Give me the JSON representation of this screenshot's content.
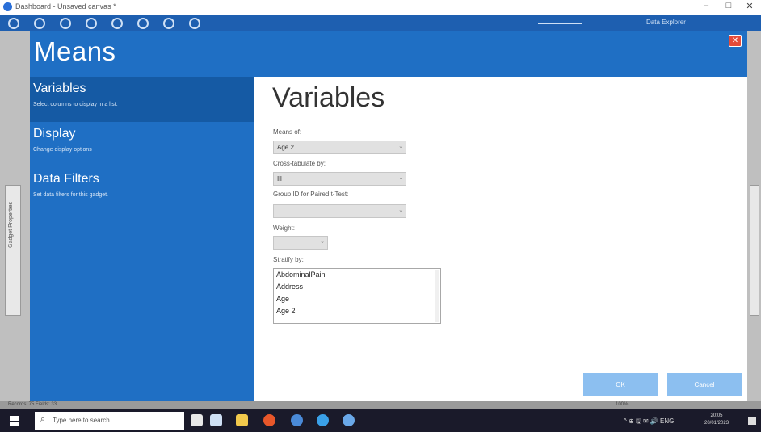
{
  "window": {
    "title": "Dashboard - Unsaved canvas *",
    "minimize_glyph": "–",
    "maximize_glyph": "□",
    "close_glyph": "✕"
  },
  "toolbar": {
    "search_text": "Data Explorer"
  },
  "dialog": {
    "title": "Means",
    "close_glyph": "✕",
    "nav": [
      {
        "title": "Variables",
        "desc": "Select columns to display in a list."
      },
      {
        "title": "Display",
        "desc": "Change display options"
      },
      {
        "title": "Data Filters",
        "desc": "Set data filters for this gadget."
      }
    ],
    "content": {
      "title": "Variables",
      "means_of": {
        "label": "Means of:",
        "value": "Age 2"
      },
      "cross_tabulate": {
        "label": "Cross-tabulate by:",
        "value": "Ill"
      },
      "group_id": {
        "label": "Group ID for Paired t-Test:",
        "value": ""
      },
      "weight": {
        "label": "Weight:",
        "value": ""
      },
      "stratify": {
        "label": "Stratify by:",
        "items": [
          "AbdominalPain",
          "Address",
          "Age",
          "Age 2"
        ]
      },
      "ok_label": "OK",
      "cancel_label": "Cancel"
    }
  },
  "side_tab_text": "Gadget Properties",
  "statusbar": {
    "left_text": "Records: 75 Fields: 33",
    "right_text": "100%"
  },
  "taskbar": {
    "search_placeholder": "Type here to search",
    "tray_text": "^ ⊕ 🖫 ✉ 🔊 ENG",
    "time": "20:05",
    "date": "20/01/2023"
  }
}
